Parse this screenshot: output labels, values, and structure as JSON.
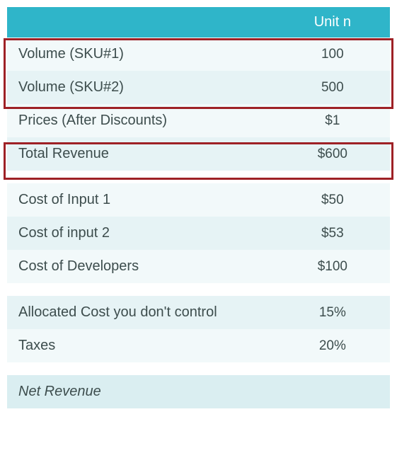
{
  "header": {
    "col1": "",
    "col2": "Unit n"
  },
  "rows": {
    "volume_sku1": {
      "label": "Volume (SKU#1)",
      "value": "100"
    },
    "volume_sku2": {
      "label": "Volume (SKU#2)",
      "value": "500"
    },
    "prices": {
      "label": "Prices (After Discounts)",
      "value": "$1"
    },
    "total_revenue": {
      "label": "Total Revenue",
      "value": "$600"
    },
    "cost_input1": {
      "label": "Cost of Input 1",
      "value": "$50"
    },
    "cost_input2": {
      "label": "Cost of input 2",
      "value": "$53"
    },
    "cost_developers": {
      "label": "Cost of Developers",
      "value": "$100"
    },
    "allocated_cost": {
      "label": "Allocated Cost you don't control",
      "value": "15%"
    },
    "taxes": {
      "label": "Taxes",
      "value": "20%"
    },
    "net_revenue": {
      "label": "Net Revenue",
      "value": ""
    }
  }
}
